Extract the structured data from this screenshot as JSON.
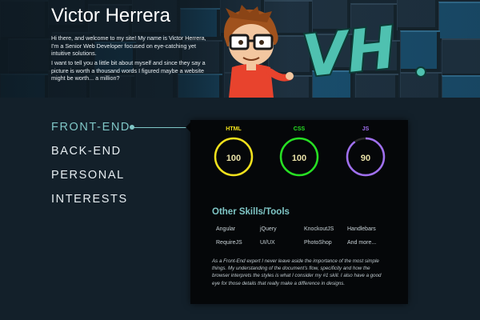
{
  "header": {
    "title": "Victor Herrera",
    "intro_p1": "Hi there, and welcome to my site! My name is Victor Herrera, I'm a Senior Web Developer focused on eye-catching yet intuitive solutions.",
    "intro_p2": "I want to tell you a little bit about myself and since they say a picture is worth a thousand words I figured maybe a website might be worth... a million?",
    "graffiti_text": "VH"
  },
  "nav": {
    "items": [
      {
        "label": "FRONT-END",
        "active": true
      },
      {
        "label": "BACK-END",
        "active": false
      },
      {
        "label": "PERSONAL",
        "active": false
      },
      {
        "label": "INTERESTS",
        "active": false
      }
    ]
  },
  "skills": [
    {
      "name": "HTML",
      "value": "100",
      "percent": 100,
      "color": "#f2e21c"
    },
    {
      "name": "CSS",
      "value": "100",
      "percent": 100,
      "color": "#27e023"
    },
    {
      "name": "JS",
      "value": "90",
      "percent": 90,
      "color": "#a070f0"
    }
  ],
  "tools": {
    "title": "Other Skills/Tools",
    "items": [
      "Angular",
      "jQuery",
      "KnockoutJS",
      "Handlebars",
      "RequireJS",
      "UI/UX",
      "PhotoShop",
      "And more..."
    ]
  },
  "description": "As a Front-End expert I never leave aside the importance of the most simple things. My understanding of the document's flow, specificity and how the browser interprets the styles is what I consider my #1 skill. I also have a good eye for those details that really make a difference in designs.",
  "colors": {
    "accent": "#7fc6c6",
    "background": "#13202a",
    "panel": "#050709"
  }
}
